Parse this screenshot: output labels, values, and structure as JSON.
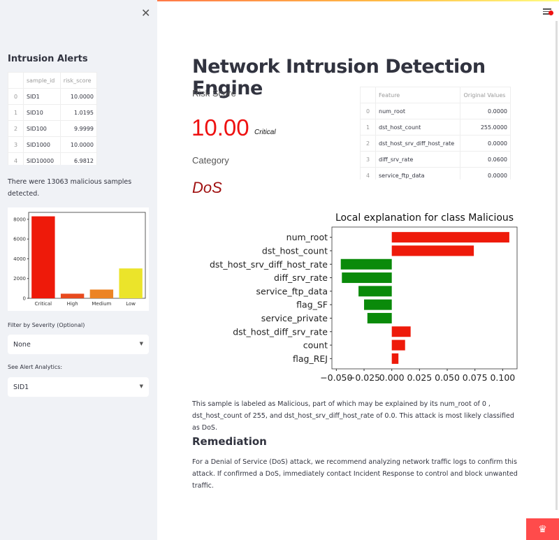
{
  "sidebar": {
    "title": "Intrusion Alerts",
    "alerts_table": {
      "columns": [
        "",
        "sample_id",
        "risk_score"
      ],
      "rows": [
        [
          "0",
          "SID1",
          "10.0000"
        ],
        [
          "1",
          "SID10",
          "1.0195"
        ],
        [
          "2",
          "SID100",
          "9.9999"
        ],
        [
          "3",
          "SID1000",
          "10.0000"
        ],
        [
          "4",
          "SID10000",
          "6.9812"
        ]
      ]
    },
    "summary": "There were 13063 malicious samples detected.",
    "filter_label": "Filter by Severity (Optional)",
    "filter_value": "None",
    "analytics_label": "See Alert Analytics:",
    "analytics_value": "SID1"
  },
  "main": {
    "title": "Network Intrusion Detection Engine",
    "risk_label": "Risk Score",
    "risk_value": "10.00",
    "risk_level": "Critical",
    "category_label": "Category",
    "category_value": "DoS",
    "feature_table": {
      "columns": [
        "",
        "Feature",
        "Original Values"
      ],
      "rows": [
        [
          "0",
          "num_root",
          "0.0000"
        ],
        [
          "1",
          "dst_host_count",
          "255.0000"
        ],
        [
          "2",
          "dst_host_srv_diff_host_rate",
          "0.0000"
        ],
        [
          "3",
          "diff_srv_rate",
          "0.0600"
        ],
        [
          "4",
          "service_ftp_data",
          "0.0000"
        ]
      ]
    },
    "explanation": "This sample is labeled as Malicious, part of which may be explained by its num_root of 0 , dst_host_count of 255, and dst_host_srv_diff_host_rate of 0.0. This attack is most likely classified as DoS.",
    "remediation_title": "Remediation",
    "remediation_text": "For a Denial of Service (DoS) attack, we recommend analyzing network traffic logs to confirm this attack. If confirmed a DoS, immediately contact Incident Response to control and block unwanted traffic."
  },
  "chart_data": [
    {
      "type": "bar",
      "title": "",
      "categories": [
        "Critical",
        "High",
        "Medium",
        "Low"
      ],
      "values": [
        8300,
        465,
        884,
        3023
      ],
      "colors": [
        "#ee1a0a",
        "#e84a1e",
        "#ec8424",
        "#ebe42a"
      ],
      "yticks": [
        0,
        2000,
        4000,
        6000,
        8000
      ],
      "ylim": [
        0,
        8700
      ]
    },
    {
      "type": "bar",
      "orientation": "horizontal",
      "title": "Local explanation for class Malicious",
      "categories": [
        "num_root",
        "dst_host_count",
        "dst_host_srv_diff_host_rate",
        "diff_srv_rate",
        "service_ftp_data",
        "flag_SF",
        "service_private",
        "dst_host_diff_srv_rate",
        "count",
        "flag_REJ"
      ],
      "values": [
        0.106,
        0.074,
        -0.046,
        -0.045,
        -0.03,
        -0.025,
        -0.022,
        0.017,
        0.012,
        0.006
      ],
      "xticks": [
        "−0.050",
        "−0.025",
        "0.000",
        "0.025",
        "0.050",
        "0.075",
        "0.100"
      ],
      "xtick_values": [
        -0.05,
        -0.025,
        0,
        0.025,
        0.05,
        0.075,
        0.1
      ],
      "xlim": [
        -0.054,
        0.113
      ],
      "positive_color": "#ee1a0a",
      "negative_color": "#0a8a0a"
    }
  ]
}
